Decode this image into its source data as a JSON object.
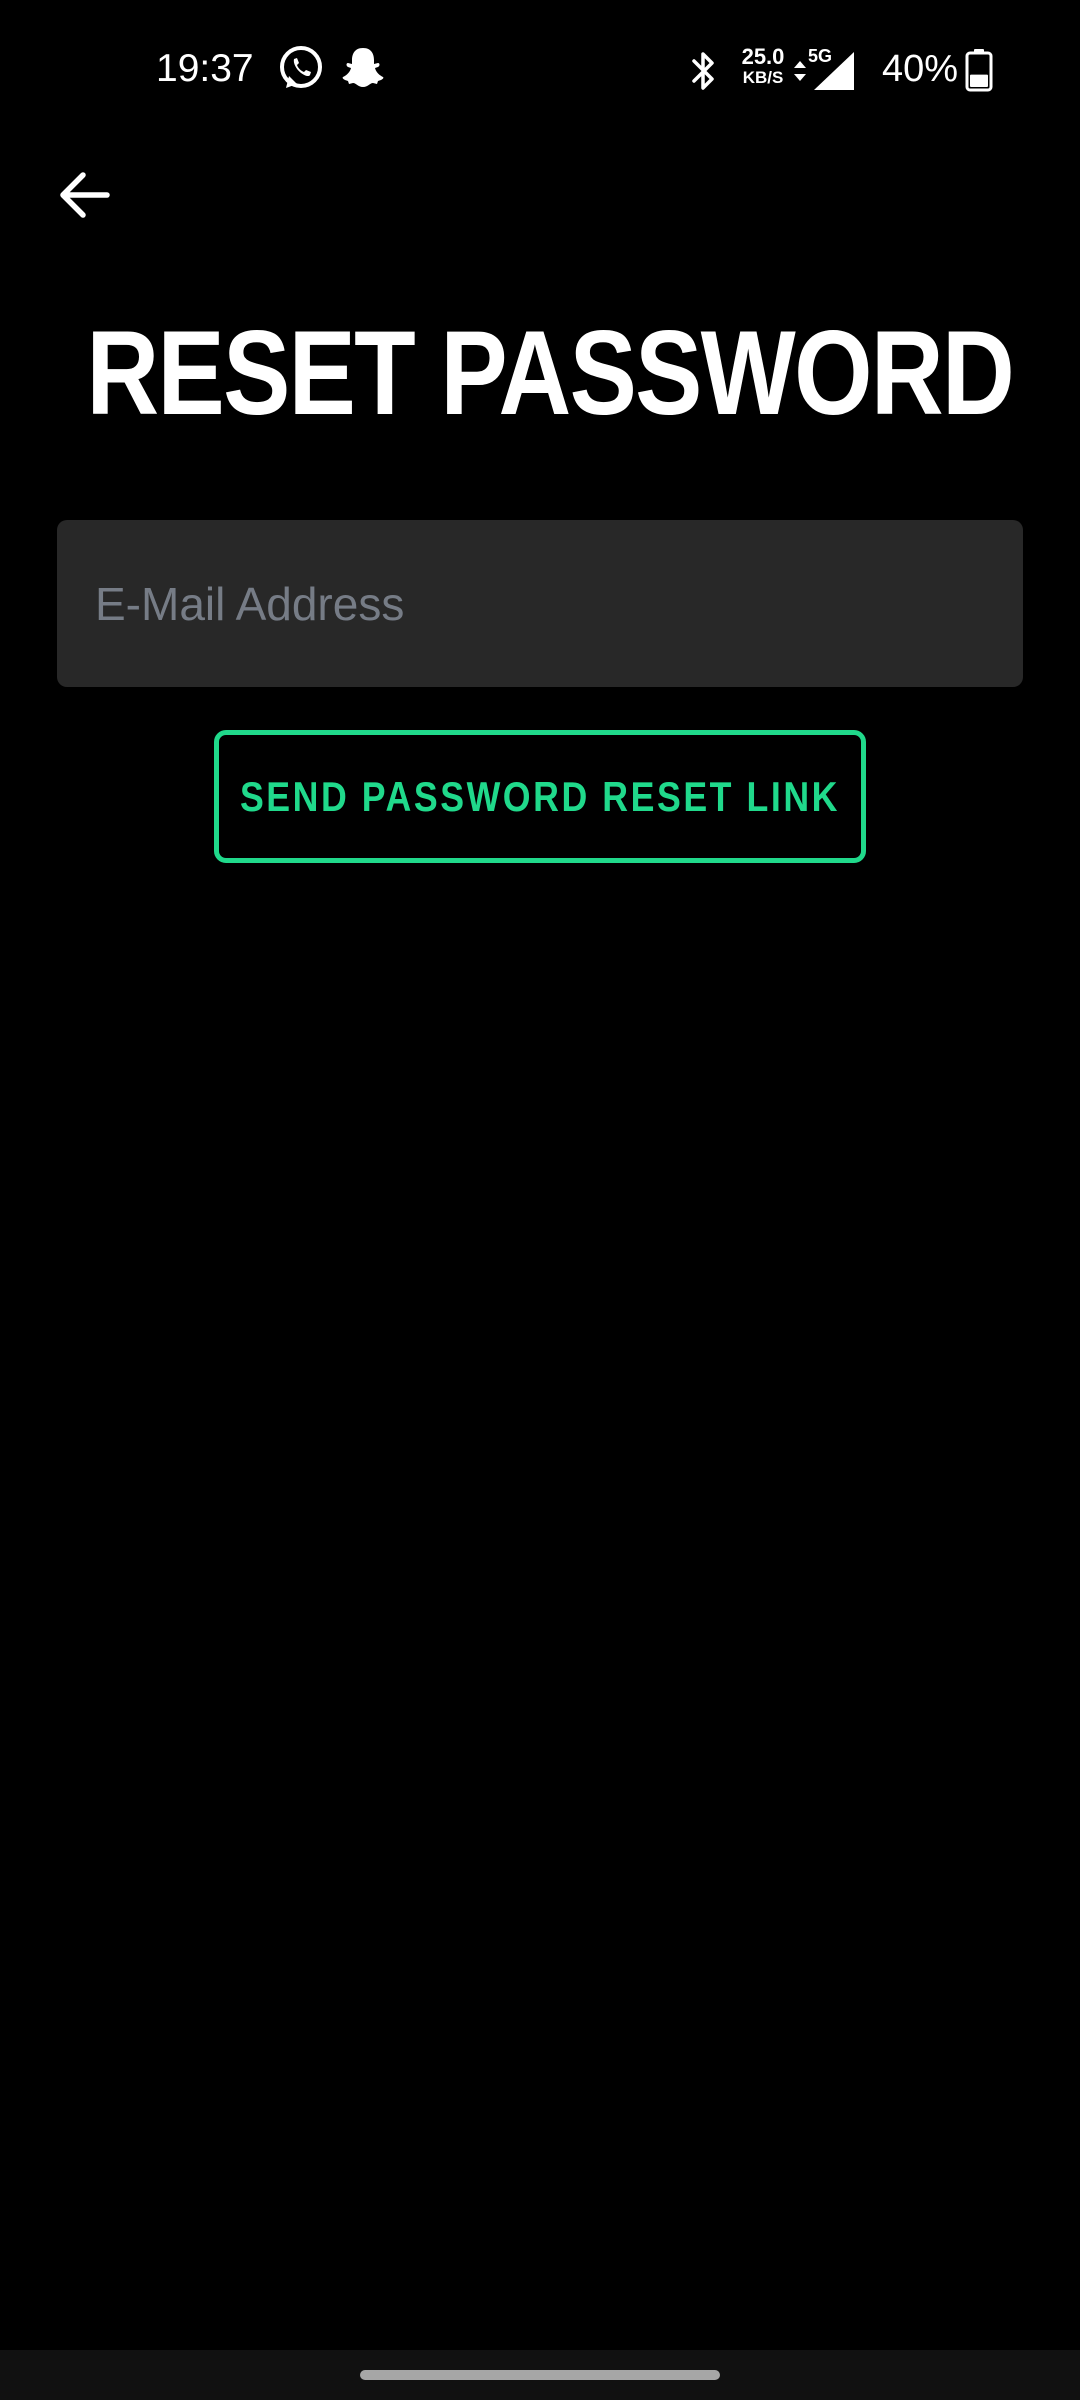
{
  "status_bar": {
    "time": "19:37",
    "notification_icons": [
      "whatsapp-icon",
      "snapchat-icon"
    ],
    "bluetooth_icon": "bluetooth-icon",
    "net_speed_value": "25.0",
    "net_speed_unit": "KB/S",
    "network_type": "5G",
    "signal_icon": "signal-icon",
    "battery_percent": "40%",
    "battery_level": 0.4
  },
  "header": {
    "back_icon": "arrow-left-icon",
    "title": "RESET PASSWORD"
  },
  "form": {
    "email_placeholder": "E-Mail Address",
    "email_value": "",
    "submit_label": "SEND PASSWORD RESET LINK"
  },
  "colors": {
    "background": "#000000",
    "input_background": "#282828",
    "placeholder": "#767c86",
    "accent": "#20d98b",
    "text": "#ffffff"
  }
}
